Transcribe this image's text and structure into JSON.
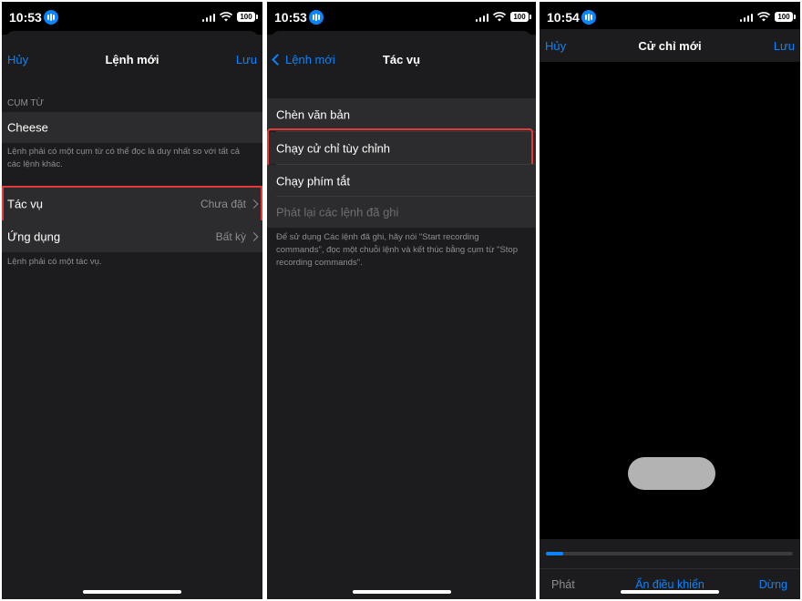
{
  "status_bars": [
    {
      "time": "10:53",
      "battery": "100"
    },
    {
      "time": "10:53",
      "battery": "100"
    },
    {
      "time": "10:54",
      "battery": "100"
    }
  ],
  "panel1": {
    "nav": {
      "cancel": "Hủy",
      "title": "Lệnh mới",
      "save": "Lưu"
    },
    "phrase_header": "CỤM TỪ",
    "phrase_value": "Cheese",
    "phrase_footnote": "Lệnh phải có một cụm từ có thể đọc là duy nhất so với tất cả các lệnh khác.",
    "action_label": "Tác vụ",
    "action_value": "Chưa đặt",
    "app_label": "Ứng dụng",
    "app_value": "Bất kỳ",
    "action_footnote": "Lệnh phải có một tác vụ."
  },
  "panel2": {
    "nav": {
      "back": "Lệnh mới",
      "title": "Tác vụ"
    },
    "items": [
      {
        "label": "Chèn văn bản",
        "enabled": true
      },
      {
        "label": "Chạy cử chỉ tùy chỉnh",
        "enabled": true
      },
      {
        "label": "Chạy phím tắt",
        "enabled": true
      },
      {
        "label": "Phát lại các lệnh đã ghi",
        "enabled": false
      }
    ],
    "footnote": "Để sử dụng Các lệnh đã ghi, hãy nói \"Start recording commands\", đọc một chuỗi lệnh và kết thúc bằng cụm từ \"Stop recording commands\"."
  },
  "panel3": {
    "nav": {
      "cancel": "Hủy",
      "title": "Cử chỉ mới",
      "save": "Lưu"
    },
    "progress": 0.07,
    "controls": {
      "play": "Phát",
      "hide": "Ẩn điều khiển",
      "stop": "Dừng"
    }
  },
  "colors": {
    "accent": "#0a84ff",
    "highlight": "#e53935",
    "background": "#1c1c1e",
    "cell": "#2c2c2e",
    "secondary_text": "#8e8e93"
  }
}
